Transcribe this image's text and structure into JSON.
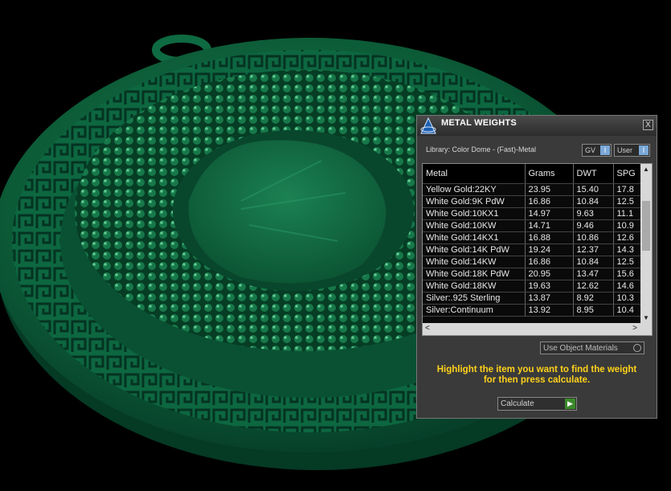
{
  "title": "METAL WEIGHTS",
  "library_label": "Library: Color Dome - (Fast)-Metal",
  "toggles": {
    "gv_label": "GV",
    "user_label": "User",
    "knob_glyph": "I"
  },
  "close_glyph": "X",
  "table": {
    "columns": [
      "Metal",
      "Grams",
      "DWT",
      "SPG"
    ],
    "rows": [
      [
        "Yellow Gold:22KY",
        "23.95",
        "15.40",
        "17.8"
      ],
      [
        "White Gold:9K PdW",
        "16.86",
        "10.84",
        "12.5"
      ],
      [
        "White Gold:10KX1",
        "14.97",
        "9.63",
        "11.1"
      ],
      [
        "White Gold:10KW",
        "14.71",
        "9.46",
        "10.9"
      ],
      [
        "White Gold:14KX1",
        "16.88",
        "10.86",
        "12.6"
      ],
      [
        "White Gold:14K PdW",
        "19.24",
        "12.37",
        "14.3"
      ],
      [
        "White Gold:14KW",
        "16.86",
        "10.84",
        "12.5"
      ],
      [
        "White Gold:18K PdW",
        "20.95",
        "13.47",
        "15.6"
      ],
      [
        "White Gold:18KW",
        "19.63",
        "12.62",
        "14.6"
      ],
      [
        "Silver:.925 Sterling",
        "13.87",
        "8.92",
        "10.3"
      ],
      [
        "Silver:Continuum",
        "13.92",
        "8.95",
        "10.4"
      ]
    ]
  },
  "use_object_materials_label": "Use Object Materials",
  "instruction_line1": "Highlight the item you want to find the weight",
  "instruction_line2": "for then press calculate.",
  "calculate_label": "Calculate",
  "colors": {
    "model_green": "#0e5a3a",
    "highlight_text": "#ffd21a",
    "panel_bg": "#3a3a3a"
  },
  "icons": {
    "app": "pyramid-logo-icon",
    "close": "close-icon",
    "go": "play-arrow-icon"
  }
}
